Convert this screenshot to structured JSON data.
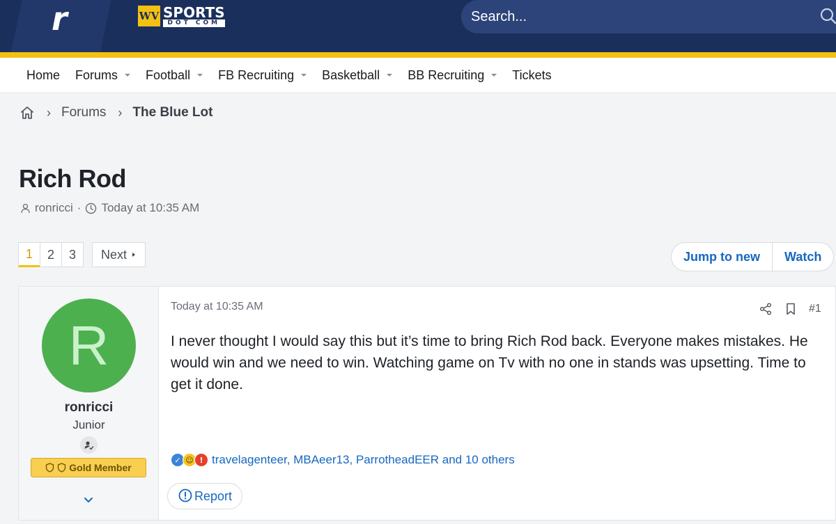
{
  "header": {
    "rivals_logo": "r",
    "brand": {
      "badge": "WV",
      "name": "SPORTS",
      "sub": "DOT COM"
    },
    "search": {
      "placeholder": "Search..."
    }
  },
  "nav": {
    "items": [
      {
        "label": "Home",
        "dropdown": false
      },
      {
        "label": "Forums",
        "dropdown": true
      },
      {
        "label": "Football",
        "dropdown": true
      },
      {
        "label": "FB Recruiting",
        "dropdown": true
      },
      {
        "label": "Basketball",
        "dropdown": true
      },
      {
        "label": "BB Recruiting",
        "dropdown": true
      },
      {
        "label": "Tickets",
        "dropdown": false
      }
    ]
  },
  "breadcrumb": {
    "home_icon": "home-icon",
    "separator": "›",
    "items": [
      "Forums",
      "The Blue Lot"
    ]
  },
  "thread": {
    "title": "Rich Rod",
    "author": "ronricci",
    "separator": "·",
    "time": "Today at 10:35 AM"
  },
  "pagination": {
    "pages": [
      "1",
      "2",
      "3"
    ],
    "current": "1",
    "next_label": "Next"
  },
  "thread_actions": {
    "jump_label": "Jump to new",
    "watch_label": "Watch"
  },
  "post": {
    "user": {
      "avatar_letter": "R",
      "name": "ronricci",
      "title": "Junior",
      "badge_label": "Gold Member"
    },
    "date": "Today at 10:35 AM",
    "number": "#1",
    "body": "I never thought I would say this but it’s time to bring Rich Rod back. Everyone makes mistakes. He would win and we need to win. Watching game on Tv with no one in stands was upsetting. Time to get it done.",
    "reactions_text": "travelagenteer, MBAeer13, ParrotheadEER and 10 others",
    "report_label": "Report"
  },
  "colors": {
    "header_bg": "#1b2f5c",
    "accent_gold": "#f2c212",
    "link_blue": "#1668c0",
    "avatar_green": "#4db04f"
  }
}
